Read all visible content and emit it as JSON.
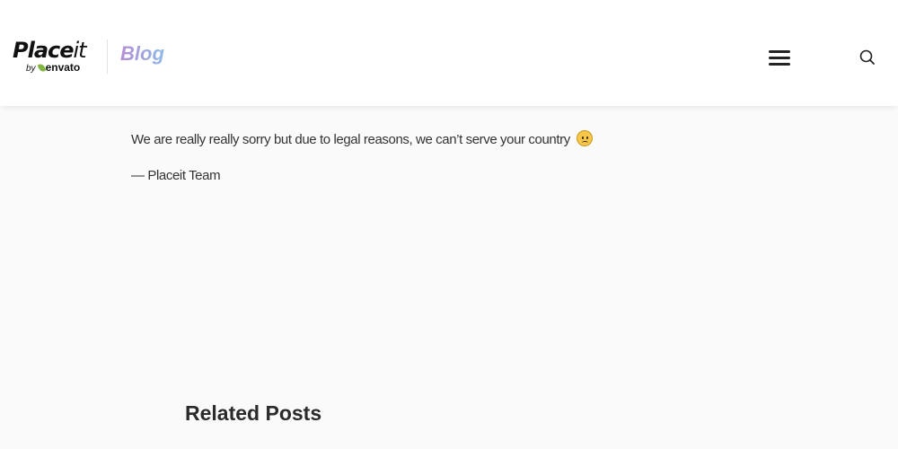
{
  "header": {
    "logo": {
      "main_text": "Place",
      "main_text_it": "it",
      "by_text": "by",
      "envato_text": "envato"
    },
    "blog_label": "Blog",
    "menu_icon": "hamburger-menu-icon",
    "search_icon": "search-icon"
  },
  "main": {
    "message": "We are really really sorry but due to legal reasons, we can’t serve your country",
    "emoji_icon": "confused-face-icon",
    "signature": "— Placeit Team",
    "related_posts_heading": "Related Posts"
  },
  "colors": {
    "page_background": "#fafafa",
    "header_background": "#ffffff",
    "blog_gradient_start": "#b48fd6",
    "blog_gradient_end": "#8fb8e6",
    "envato_leaf": "#82b541",
    "text": "#333333"
  }
}
